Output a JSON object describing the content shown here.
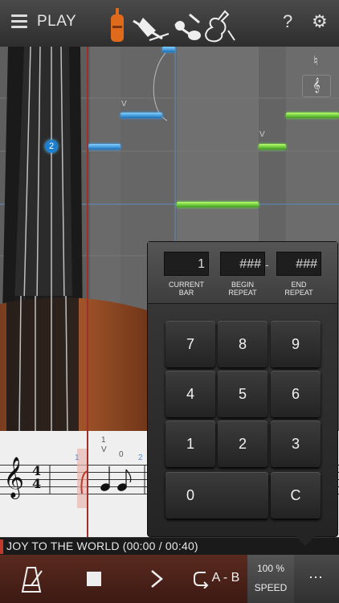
{
  "topbar": {
    "menu_icon": "hamburger-icon",
    "play_label": "PLAY",
    "mode_icons": [
      "violin-icon",
      "bowing-icon",
      "hands-icon",
      "violin-outline-icon"
    ],
    "help_label": "?",
    "settings_icon": "gear-icon"
  },
  "stage": {
    "finger_number": "2",
    "bow_mark": "V",
    "clef_panel": [
      "violin-small-icon",
      "treble-clef-icon"
    ]
  },
  "keypad": {
    "current_bar_value": "1",
    "begin_repeat_value": "###",
    "end_repeat_value": "###",
    "separator": "-",
    "labels": {
      "current_bar": "CURRENT\nBAR",
      "begin_repeat": "BEGIN\nREPEAT",
      "end_repeat": "END\nREPEAT"
    },
    "keys": [
      "7",
      "8",
      "9",
      "4",
      "5",
      "6",
      "1",
      "2",
      "3",
      "0",
      "C"
    ]
  },
  "score": {
    "time_signature_top": "4",
    "time_signature_bottom": "4",
    "mark_1": "1",
    "mark_v": "V",
    "mark_0": "0",
    "mark_2": "2",
    "mark_1b": "1"
  },
  "song": {
    "title": "JOY TO THE WORLD (00:00 / 00:40)"
  },
  "transport": {
    "metronome_icon": "metronome-icon",
    "stop_icon": "stop-icon",
    "play_icon": "play-chevron-icon",
    "ab_label": "A - B",
    "speed_value": "100 %",
    "speed_label": "SPEED",
    "more_label": "⋯"
  }
}
